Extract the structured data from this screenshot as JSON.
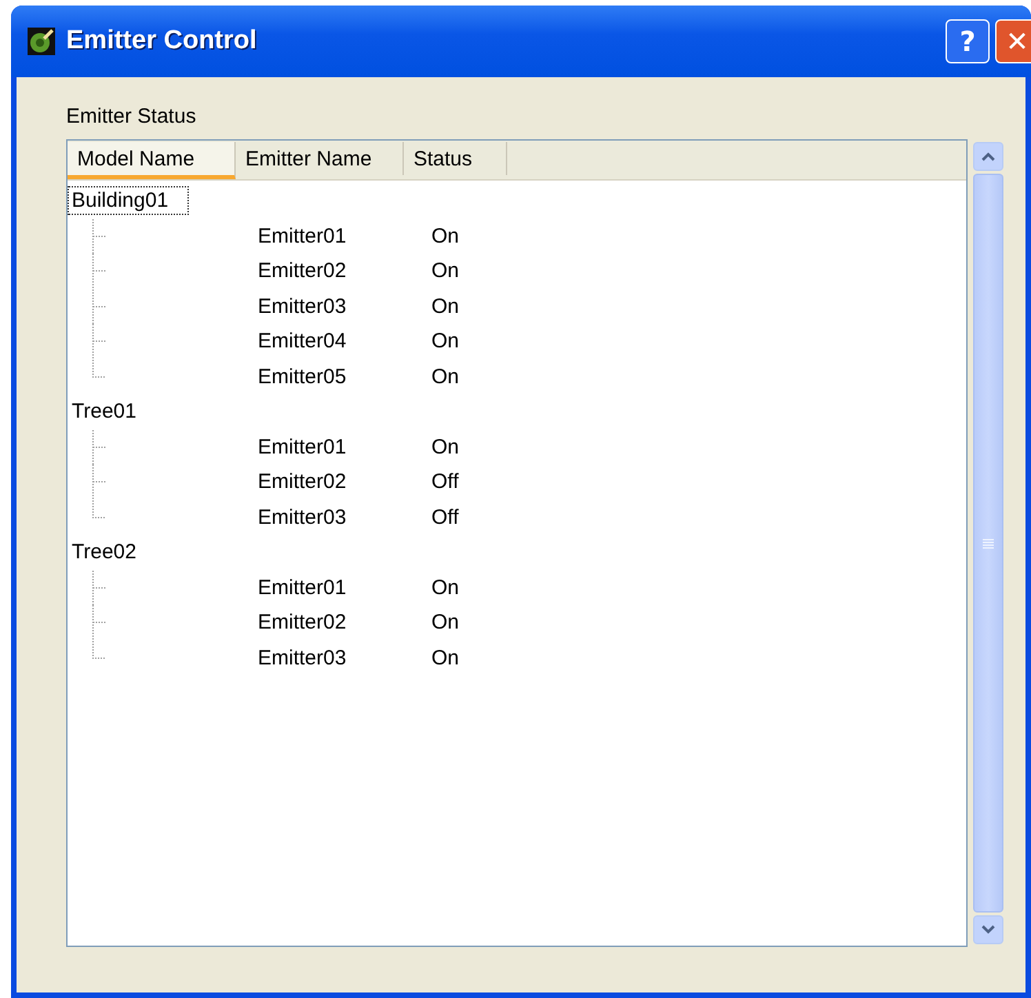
{
  "window": {
    "title": "Emitter Control",
    "buttons": [
      "?",
      "✕"
    ]
  },
  "group_label": "Emitter Status",
  "columns": [
    {
      "label": "Model Name",
      "selected": true
    },
    {
      "label": "Emitter Name",
      "selected": false
    },
    {
      "label": "Status",
      "selected": false
    }
  ],
  "models": [
    {
      "name": "Building01",
      "selected": true,
      "children": [
        {
          "name": "Emitter01",
          "status": "On"
        },
        {
          "name": "Emitter02",
          "status": "On"
        },
        {
          "name": "Emitter03",
          "status": "On"
        },
        {
          "name": "Emitter04",
          "status": "On"
        },
        {
          "name": "Emitter05",
          "status": "On"
        }
      ]
    },
    {
      "name": "Tree01",
      "selected": false,
      "children": [
        {
          "name": "Emitter01",
          "status": "On"
        },
        {
          "name": "Emitter02",
          "status": "Off"
        },
        {
          "name": "Emitter03",
          "status": "Off"
        }
      ]
    },
    {
      "name": "Tree02",
      "selected": false,
      "children": [
        {
          "name": "Emitter01",
          "status": "On"
        },
        {
          "name": "Emitter02",
          "status": "On"
        },
        {
          "name": "Emitter03",
          "status": "On"
        }
      ]
    }
  ]
}
